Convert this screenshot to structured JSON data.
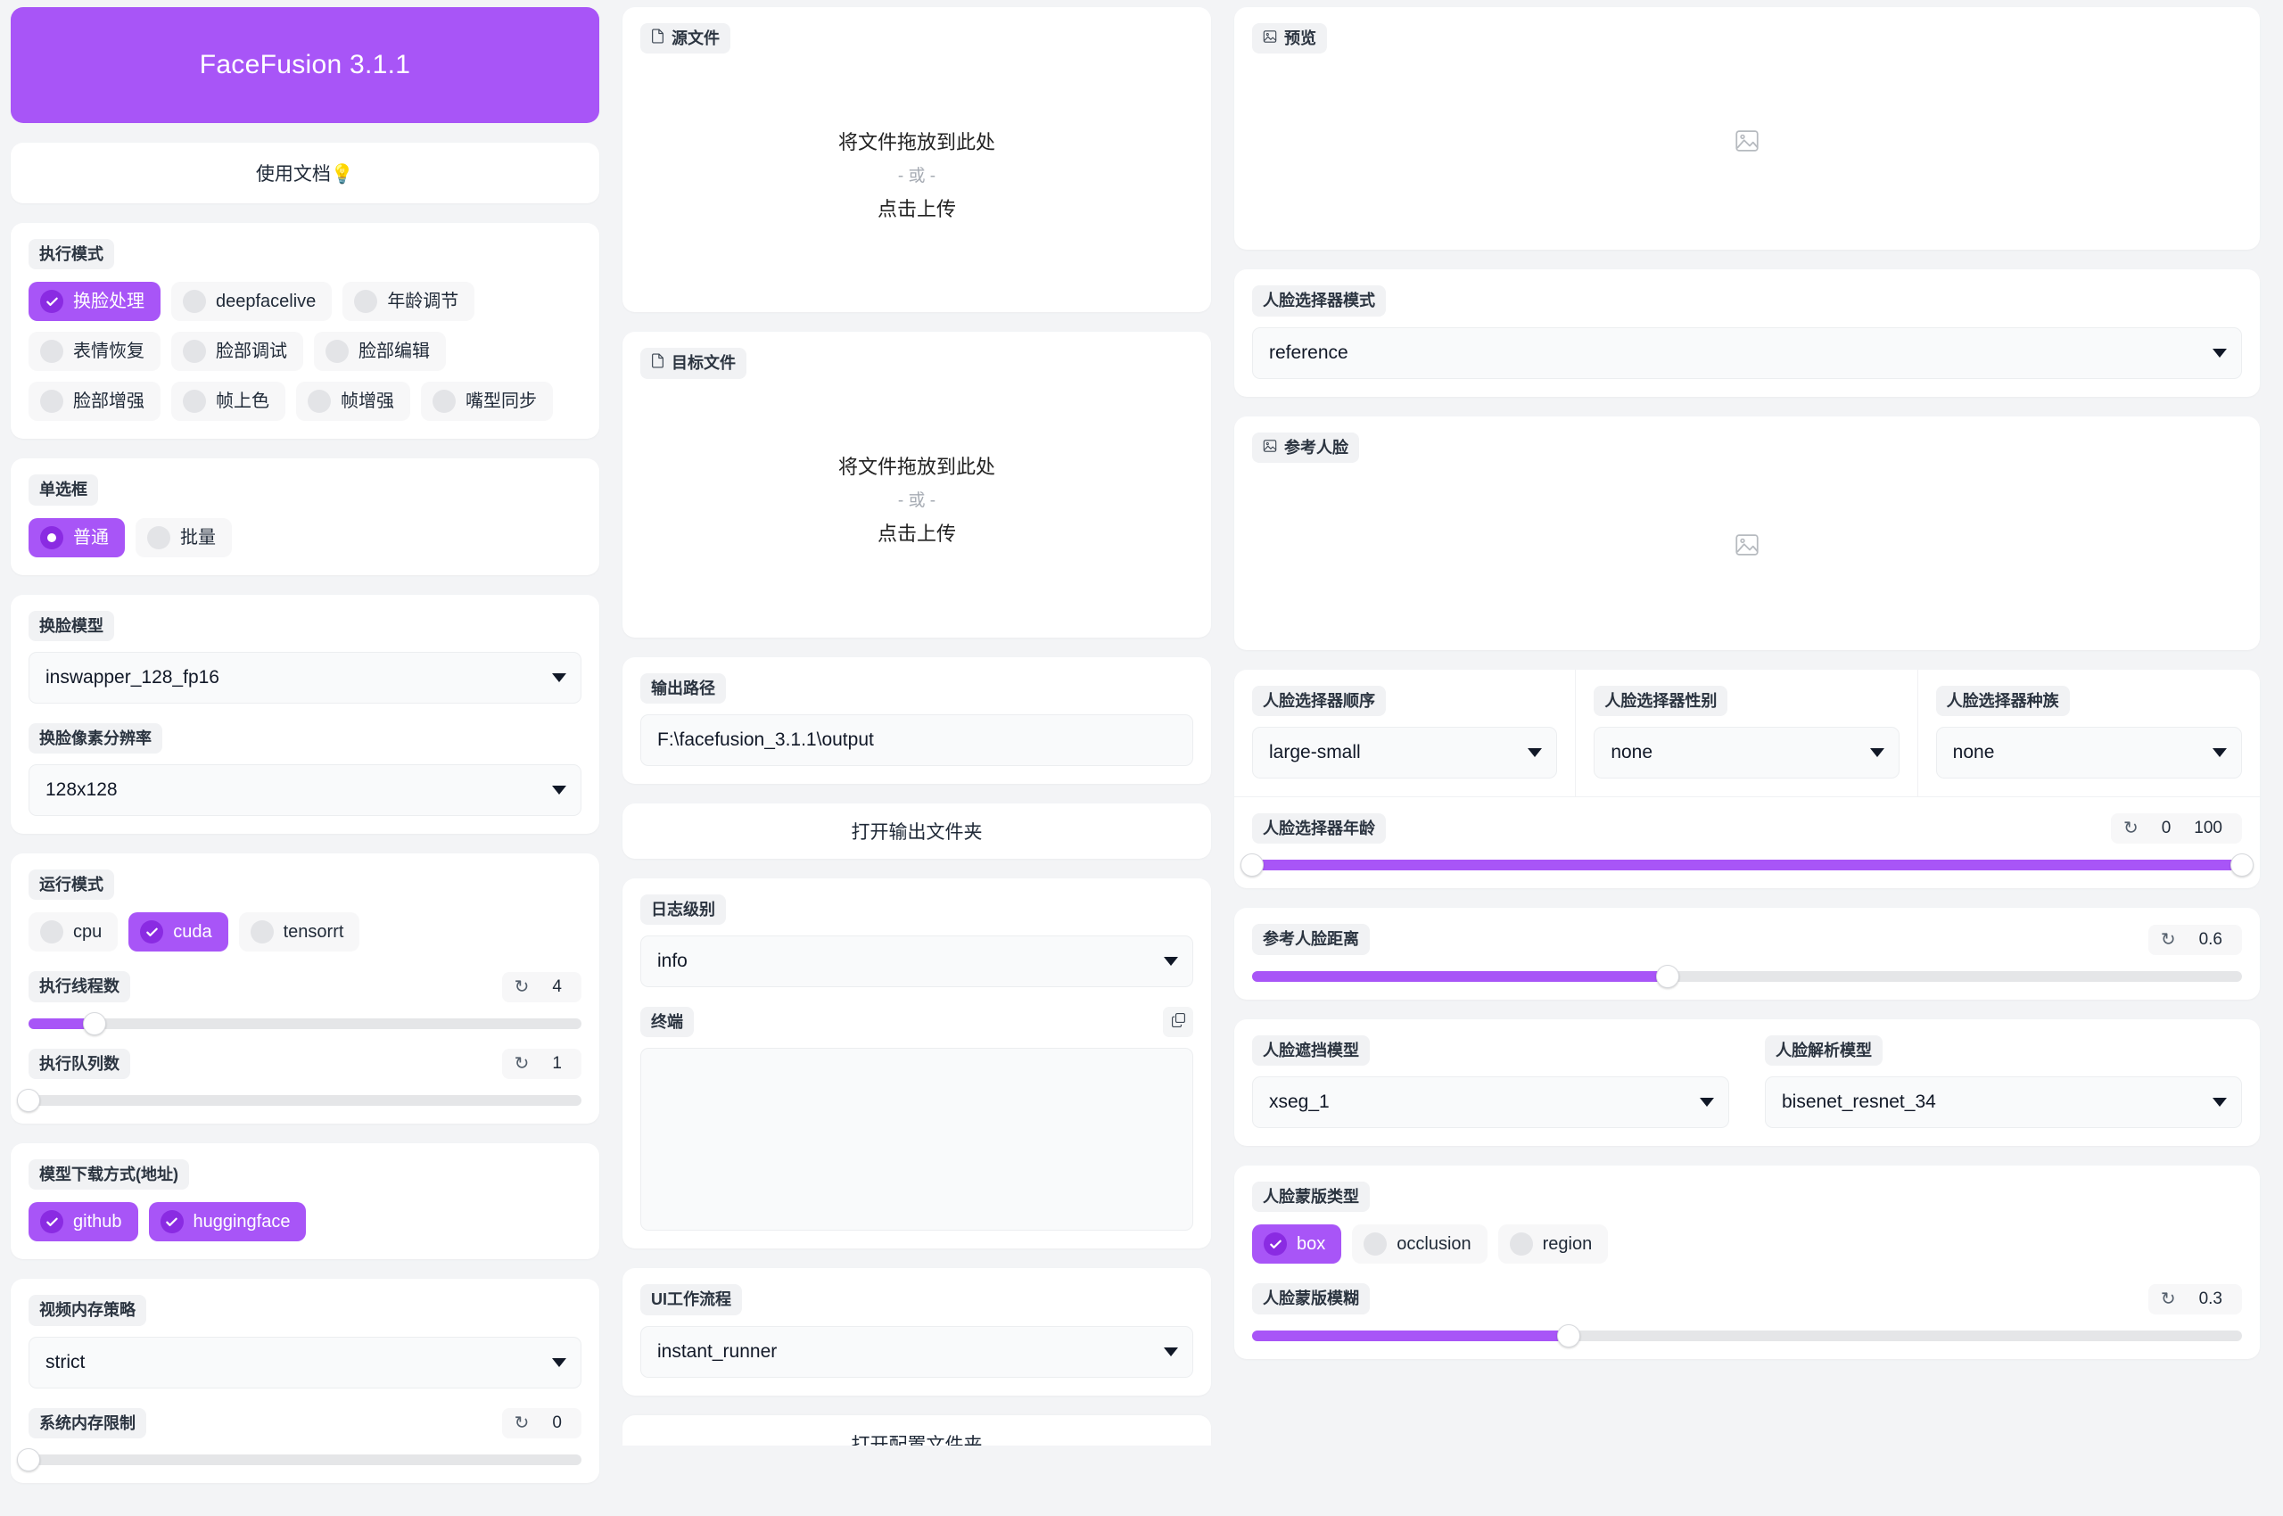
{
  "app": {
    "title": "FaceFusion 3.1.1",
    "accent_color": "#a855f7",
    "accent_dark": "#8a2be2",
    "page_bg": "#f3f4f6"
  },
  "docs": {
    "label": "使用文档💡"
  },
  "execution_mode": {
    "label": "执行模式",
    "options": [
      {
        "label": "换脸处理",
        "checked": true
      },
      {
        "label": "deepfacelive",
        "checked": false
      },
      {
        "label": "年龄调节",
        "checked": false
      },
      {
        "label": "表情恢复",
        "checked": false
      },
      {
        "label": "脸部调试",
        "checked": false
      },
      {
        "label": "脸部编辑",
        "checked": false
      },
      {
        "label": "脸部增强",
        "checked": false
      },
      {
        "label": "帧上色",
        "checked": false
      },
      {
        "label": "帧增强",
        "checked": false
      },
      {
        "label": "嘴型同步",
        "checked": false
      }
    ]
  },
  "radio_group": {
    "label": "单选框",
    "options": [
      {
        "label": "普通",
        "checked": true
      },
      {
        "label": "批量",
        "checked": false
      }
    ]
  },
  "swap_model": {
    "label": "换脸模型",
    "value": "inswapper_128_fp16"
  },
  "swap_resolution": {
    "label": "换脸像素分辨率",
    "value": "128x128"
  },
  "run_mode": {
    "label": "运行模式",
    "options": [
      {
        "label": "cpu",
        "checked": false
      },
      {
        "label": "cuda",
        "checked": true
      },
      {
        "label": "tensorrt",
        "checked": false
      }
    ]
  },
  "thread_count": {
    "label": "执行线程数",
    "value": "4",
    "reset_icon": "reset-icon",
    "fill_percent": 12
  },
  "queue_count": {
    "label": "执行队列数",
    "value": "1",
    "reset_icon": "reset-icon",
    "fill_percent": 0
  },
  "download_provider": {
    "label": "模型下载方式(地址)",
    "options": [
      {
        "label": "github",
        "checked": true
      },
      {
        "label": "huggingface",
        "checked": true
      }
    ]
  },
  "video_memory_strategy": {
    "label": "视频内存策略",
    "value": "strict"
  },
  "system_memory_limit": {
    "label": "系统内存限制",
    "value": "0",
    "reset_icon": "reset-icon",
    "fill_percent": 0
  },
  "source_file": {
    "label": "源文件",
    "icon": "file-icon",
    "drop_text": "将文件拖放到此处",
    "or_text": "- 或 -",
    "click_text": "点击上传"
  },
  "target_file": {
    "label": "目标文件",
    "icon": "file-icon",
    "drop_text": "将文件拖放到此处",
    "or_text": "- 或 -",
    "click_text": "点击上传"
  },
  "output_path": {
    "label": "输出路径",
    "value": "F:\\facefusion_3.1.1\\output"
  },
  "open_output_folder": {
    "label": "打开输出文件夹"
  },
  "log_level": {
    "label": "日志级别",
    "value": "info"
  },
  "terminal": {
    "label": "终端",
    "copy_icon": "copy-icon",
    "content": ""
  },
  "ui_workflow": {
    "label": "UI工作流程",
    "value": "instant_runner"
  },
  "bottom_button": {
    "label": "打开配置文件夹"
  },
  "preview": {
    "label": "预览",
    "icon": "image-icon",
    "placeholder_icon": "image-placeholder-icon"
  },
  "face_selector_mode": {
    "label": "人脸选择器模式",
    "value": "reference"
  },
  "reference_face": {
    "label": "参考人脸",
    "icon": "image-icon",
    "placeholder_icon": "image-placeholder-icon"
  },
  "face_selector_order": {
    "label": "人脸选择器顺序",
    "value": "large-small"
  },
  "face_selector_gender": {
    "label": "人脸选择器性别",
    "value": "none"
  },
  "face_selector_race": {
    "label": "人脸选择器种族",
    "value": "none"
  },
  "face_selector_age": {
    "label": "人脸选择器年龄",
    "reset_icon": "reset-icon",
    "min_value": "0",
    "max_value": "100",
    "fill_start_percent": 0,
    "fill_end_percent": 100
  },
  "reference_face_distance": {
    "label": "参考人脸距离",
    "value": "0.6",
    "reset_icon": "reset-icon",
    "fill_percent": 42
  },
  "face_occluder_model": {
    "label": "人脸遮挡模型",
    "value": "xseg_1"
  },
  "face_parser_model": {
    "label": "人脸解析模型",
    "value": "bisenet_resnet_34"
  },
  "face_mask_types": {
    "label": "人脸蒙版类型",
    "options": [
      {
        "label": "box",
        "checked": true
      },
      {
        "label": "occlusion",
        "checked": false
      },
      {
        "label": "region",
        "checked": false
      }
    ]
  },
  "face_mask_blur": {
    "label": "人脸蒙版模糊",
    "value": "0.3",
    "reset_icon": "reset-icon",
    "fill_percent": 32
  }
}
